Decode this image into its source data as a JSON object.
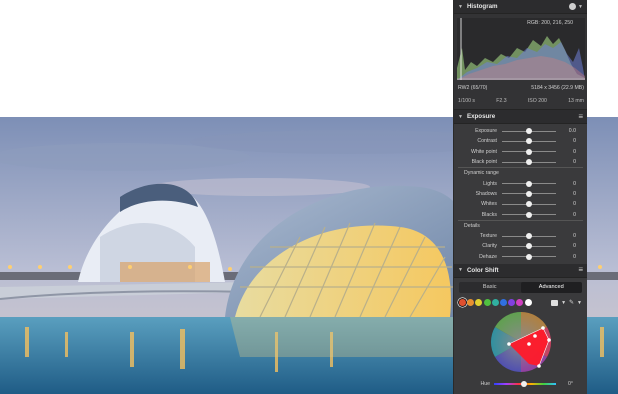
{
  "histogram": {
    "title": "Histogram",
    "rgb_readout": "RGB: 200, 216, 250",
    "file_name": "RW2 (65/70)",
    "dimensions": "5184 x 3456 (22.9 MB)",
    "shutter": "1/100 s",
    "aperture": "F2.3",
    "iso": "ISO 200",
    "focal_length": "13 mm"
  },
  "exposure": {
    "title": "Exposure",
    "rows": [
      {
        "label": "Exposure",
        "value": "0.0",
        "knob": 0.5
      },
      {
        "label": "Contrast",
        "value": "0",
        "knob": 0.5
      },
      {
        "label": "White point",
        "value": "0",
        "knob": 0.5
      },
      {
        "label": "Black point",
        "value": "0",
        "knob": 0.5
      }
    ],
    "dynamic_range_label": "Dynamic range",
    "dynamic_rows": [
      {
        "label": "Lights",
        "value": "0",
        "knob": 0.5
      },
      {
        "label": "Shadows",
        "value": "0",
        "knob": 0.5
      },
      {
        "label": "Whites",
        "value": "0",
        "knob": 0.5
      },
      {
        "label": "Blacks",
        "value": "0",
        "knob": 0.5
      }
    ],
    "details_label": "Details",
    "detail_rows": [
      {
        "label": "Texture",
        "value": "0",
        "knob": 0.5
      },
      {
        "label": "Clarity",
        "value": "0",
        "knob": 0.5
      },
      {
        "label": "Dehaze",
        "value": "0",
        "knob": 0.5
      }
    ]
  },
  "color_shift": {
    "title": "Color Shift",
    "tab_basic": "Basic",
    "tab_advanced": "Advanced",
    "swatch_colors": [
      "#e05030",
      "#e89030",
      "#e0d030",
      "#50c040",
      "#30b0a0",
      "#3070e0",
      "#8040e0",
      "#d040c0",
      "#ffffff"
    ],
    "hue_label": "Hue",
    "hue_value": "0°"
  },
  "icons": {
    "collapse": "chevron-down-icon",
    "menu": "hamburger-menu-icon",
    "eyedropper": "eyedropper-icon",
    "target": "target-icon"
  }
}
